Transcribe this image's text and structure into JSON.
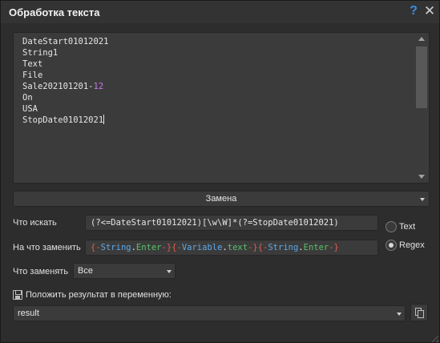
{
  "window": {
    "title": "Обработка текста",
    "help_glyph": "?",
    "close_glyph": "✕"
  },
  "editor": {
    "lines": [
      "DateStart01012021",
      "String1",
      "Text",
      "File",
      "Sale202101201-",
      "On",
      "USA",
      "StopDate01012021"
    ],
    "line5_number": "12"
  },
  "mode": {
    "selected": "Замена"
  },
  "search": {
    "label": "Что искать",
    "value": "(?<=DateStart01012021)[\\w\\W]*(?=StopDate01012021)"
  },
  "replace": {
    "label": "На что заменить",
    "tokens": [
      "{-",
      "String",
      ".",
      "Enter",
      "-}",
      "{-",
      "Variable",
      ".",
      "text",
      "-}",
      "{-",
      "String",
      ".",
      "Enter",
      "-}"
    ]
  },
  "options": {
    "text_label": "Text",
    "regex_label": "Regex",
    "selected": "Regex"
  },
  "what_replace": {
    "label": "Что заменять",
    "selected": "Все"
  },
  "result": {
    "label": "Положить результат в переменную:",
    "variable": "result"
  },
  "colors": {
    "accent_help": "#3a8ee6",
    "regex_operator": "#e05e4c",
    "regex_keyword": "#5fa8e8",
    "regex_member": "#5ac06a",
    "number_highlight": "#c87ae8"
  }
}
